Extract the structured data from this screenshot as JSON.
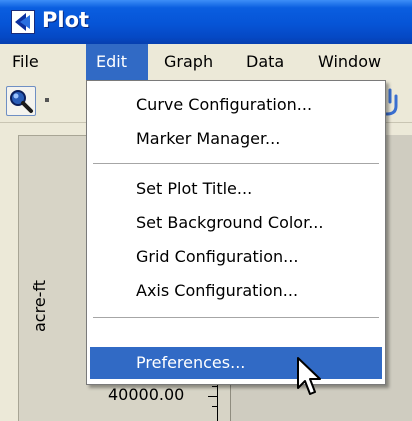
{
  "window": {
    "title": "Plot"
  },
  "menubar": {
    "items": [
      {
        "label": "File"
      },
      {
        "label": "Edit"
      },
      {
        "label": "Graph"
      },
      {
        "label": "Data"
      },
      {
        "label": "Window"
      }
    ],
    "active_index": 1
  },
  "edit_menu": {
    "items": [
      {
        "label": "Curve Configuration..."
      },
      {
        "label": "Marker Manager..."
      },
      {
        "label": "Set Plot Title..."
      },
      {
        "label": "Set Background Color..."
      },
      {
        "label": "Grid Configuration..."
      },
      {
        "label": "Axis Configuration..."
      },
      {
        "label": "Preferences..."
      }
    ],
    "highlighted_index": 6
  },
  "plot": {
    "y_axis_label": "acre-ft",
    "y_tick_label": "40000.00"
  },
  "colors": {
    "titlebar": "#0654d6",
    "menu_highlight": "#316ac5",
    "chrome": "#ece9d8"
  },
  "icons": {
    "app": "plot-app-icon",
    "toolbar_zoom": "magnifier-icon",
    "toolbar_right": "pan-hand-icon",
    "cursor": "arrow-cursor-icon"
  }
}
